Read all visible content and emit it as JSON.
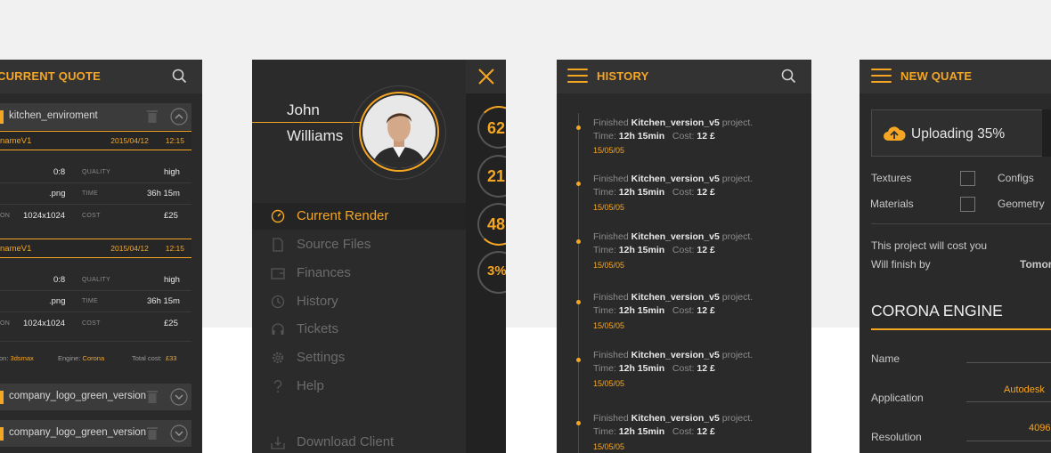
{
  "colors": {
    "accent": "#f5a623",
    "panel": "#2a2a2a",
    "header": "#333333",
    "background": "#f1f1f1"
  },
  "quote": {
    "title": "CURRENT QUOTE",
    "rows": [
      {
        "label": "kitchen_enviroment"
      },
      {
        "label": "company_logo_green_version"
      },
      {
        "label": "company_logo_green_version"
      }
    ],
    "blocks": [
      {
        "name": "nameV1",
        "date": "2015/04/12",
        "time": "12:15",
        "v1": "0:8",
        "k1": "QUALITY",
        "v1b": "high",
        "v2": ".png",
        "k2": "TIME",
        "v2b": "36h 15m",
        "k3a": "ON",
        "v3": "1024x1024",
        "k3": "COST",
        "v3b": "£25"
      },
      {
        "name": "nameV1",
        "date": "2015/04/12",
        "time": "12:15",
        "v1": "0:8",
        "k1": "QUALITY",
        "v1b": "high",
        "v2": ".png",
        "k2": "TIME",
        "v2b": "36h 15m",
        "k3a": "ON",
        "v3": "1024x1024",
        "k3": "COST",
        "v3b": "£25"
      }
    ],
    "footer": {
      "app_label": "on:",
      "app": "3dsmax",
      "engine_label": "Engine:",
      "engine": "Corona",
      "total_label": "Total cost:",
      "total": "£33"
    }
  },
  "drawer": {
    "first_name": "John",
    "last_name": "Williams",
    "menu": [
      {
        "label": "Current Render",
        "icon": "gauge-icon"
      },
      {
        "label": "Source Files",
        "icon": "file-icon"
      },
      {
        "label": "Finances",
        "icon": "wallet-icon"
      },
      {
        "label": "History",
        "icon": "clock-icon"
      },
      {
        "label": "Tickets",
        "icon": "headset-icon"
      },
      {
        "label": "Settings",
        "icon": "gear-icon"
      },
      {
        "label": "Help",
        "icon": "question-icon"
      },
      {
        "label": "Download Client",
        "icon": "download-icon"
      }
    ],
    "stats": [
      "62",
      "21",
      "48",
      "3%"
    ]
  },
  "history": {
    "title": "HISTORY",
    "items": [
      {
        "pre": "Finished",
        "project": "Kitchen_version_v5",
        "post": "project.",
        "time_label": "Time:",
        "time": "12h 15min",
        "cost_label": "Cost:",
        "cost": "12 £",
        "date": "15/05/05"
      },
      {
        "pre": "Finished",
        "project": "Kitchen_version_v5",
        "post": "project.",
        "time_label": "Time:",
        "time": "12h 15min",
        "cost_label": "Cost:",
        "cost": "12 £",
        "date": "15/05/05"
      },
      {
        "pre": "Finished",
        "project": "Kitchen_version_v5",
        "post": "project.",
        "time_label": "Time:",
        "time": "12h 15min",
        "cost_label": "Cost:",
        "cost": "12 £",
        "date": "15/05/05"
      },
      {
        "pre": "Finished",
        "project": "Kitchen_version_v5",
        "post": "project.",
        "time_label": "Time:",
        "time": "12h 15min",
        "cost_label": "Cost:",
        "cost": "12 £",
        "date": "15/05/05"
      },
      {
        "pre": "Finished",
        "project": "Kitchen_version_v5",
        "post": "project.",
        "time_label": "Time:",
        "time": "12h 15min",
        "cost_label": "Cost:",
        "cost": "12 £",
        "date": "15/05/05"
      },
      {
        "pre": "Finished",
        "project": "Kitchen_version_v5",
        "post": "project.",
        "time_label": "Time:",
        "time": "12h 15min",
        "cost_label": "Cost:",
        "cost": "12 £",
        "date": "15/05/05"
      }
    ]
  },
  "new_quote": {
    "title": "NEW QUATE",
    "upload": "Uploading 35%",
    "options": [
      "Textures",
      "Configs",
      "Materials",
      "Geometry"
    ],
    "cost_text": "This project will cost you",
    "finish_text": "Will finish by",
    "finish_value": "Tomor",
    "engine": "CORONA ENGINE",
    "fields": [
      {
        "label": "Name",
        "value": ""
      },
      {
        "label": "Application",
        "value": "Autodesk"
      },
      {
        "label": "Resolution",
        "value": "4096"
      }
    ]
  }
}
